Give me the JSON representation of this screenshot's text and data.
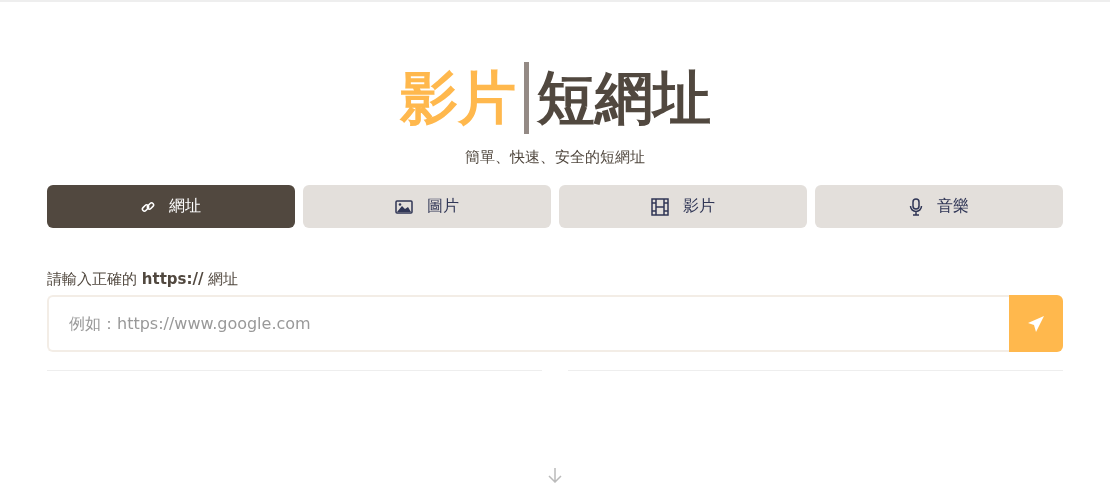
{
  "logo": {
    "highlight": "影片",
    "text": "短網址"
  },
  "tagline": "簡單、快速、安全的短網址",
  "tabs": [
    {
      "label": "網址",
      "kind": "link",
      "selected": true
    },
    {
      "label": "圖片",
      "kind": "image",
      "selected": false
    },
    {
      "label": "影片",
      "kind": "film",
      "selected": false
    },
    {
      "label": "音樂",
      "kind": "mic",
      "selected": false
    }
  ],
  "url_field": {
    "label": "請輸入正確的 **https://** 網址",
    "placeholder": "例如：https://www.google.com"
  }
}
